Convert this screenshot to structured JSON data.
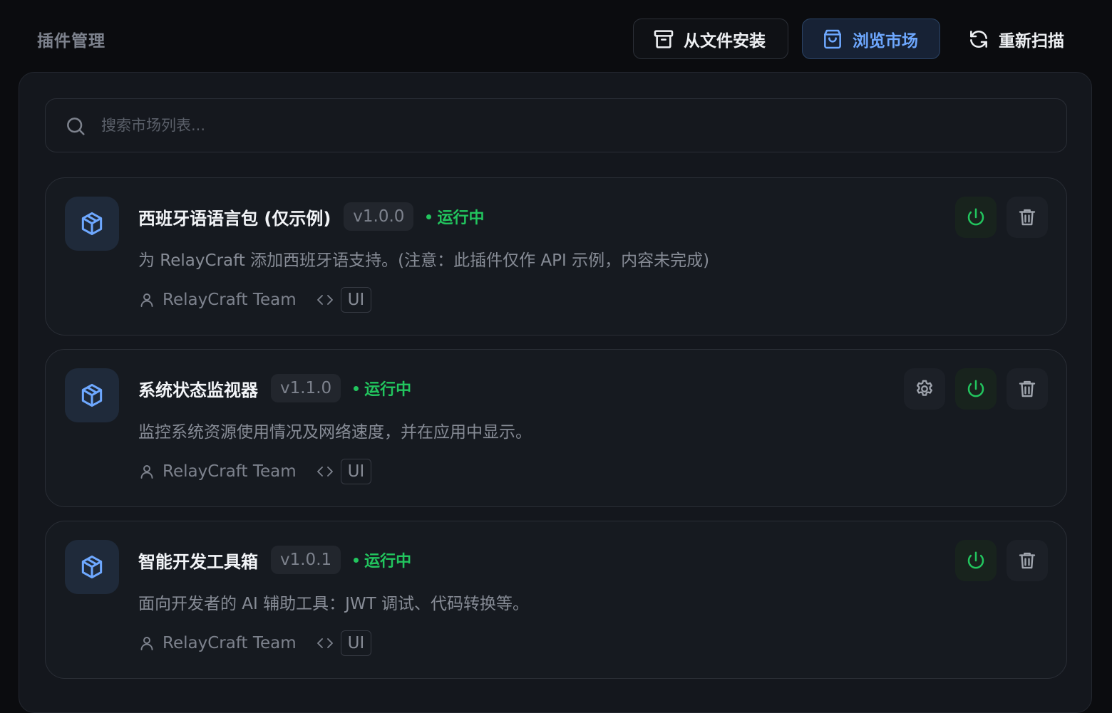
{
  "header": {
    "title": "插件管理",
    "install_label": "从文件安装",
    "market_label": "浏览市场",
    "rescan_label": "重新扫描"
  },
  "search": {
    "placeholder": "搜索市场列表..."
  },
  "plugins": [
    {
      "name": "西班牙语语言包 (仅示例)",
      "version": "v1.0.0",
      "status": "运行中",
      "description": "为 RelayCraft 添加西班牙语支持。(注意：此插件仅作 API 示例，内容未完成)",
      "author": "RelayCraft Team",
      "tag": "UI",
      "has_settings": false
    },
    {
      "name": "系统状态监视器",
      "version": "v1.1.0",
      "status": "运行中",
      "description": "监控系统资源使用情况及网络速度，并在应用中显示。",
      "author": "RelayCraft Team",
      "tag": "UI",
      "has_settings": true
    },
    {
      "name": "智能开发工具箱",
      "version": "v1.0.1",
      "status": "运行中",
      "description": "面向开发者的 AI 辅助工具：JWT 调试、代码转换等。",
      "author": "RelayCraft Team",
      "tag": "UI",
      "has_settings": false
    }
  ],
  "colors": {
    "background": "#0b0c0f",
    "panel": "#14171d",
    "accent_blue": "#6ea8ff",
    "status_green": "#22c55e"
  },
  "icons": {
    "install": "archive-box-icon",
    "market": "shopping-bag-icon",
    "rescan": "refresh-icon",
    "search": "search-icon",
    "plugin": "package-cube-icon",
    "author": "user-icon",
    "tag": "code-brackets-icon",
    "settings": "gear-icon",
    "power": "power-icon",
    "delete": "trash-icon"
  }
}
